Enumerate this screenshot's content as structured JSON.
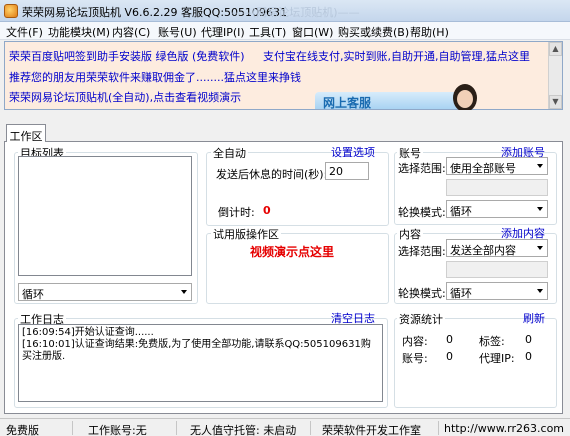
{
  "window": {
    "title": "荣荣网易论坛顶贴机 V6.6.2.29  客服QQ:505109631",
    "ghost_title": "——(网易论坛顶贴机)——"
  },
  "menu": [
    "文件(F)",
    "功能模块(M)",
    "内容(C)",
    "账号(U)",
    "代理IP(I)",
    "工具(T)",
    "窗口(W)",
    "购买或续费(B)",
    "帮助(H)"
  ],
  "banner": {
    "line1a": "荣荣百度贴吧签到助手安装版 绿色版 (免费软件)",
    "line1b": "支付宝在线支付,实时到账,自助开通,自助管理,猛点这里",
    "line2": "推荐您的朋友用荣荣软件来赚取佣金了........猛点这里来挣钱",
    "line3": "荣荣网易论坛顶贴机(全自动),点击查看视频演示",
    "service": "网上客服"
  },
  "tab": {
    "label": "工作区"
  },
  "targets": {
    "title": "目标列表",
    "loop_value": "循环"
  },
  "auto": {
    "title": "全自动",
    "settings_link": "设置选项",
    "rest_label": "发送后休息的时间(秒):",
    "rest_value": "20",
    "countdown_label": "倒计时:",
    "countdown_value": "0"
  },
  "trial": {
    "title": "试用版操作区",
    "video_text": "视频演示点这里"
  },
  "account": {
    "title": "账号",
    "add_link": "添加账号",
    "range_label": "选择范围:",
    "range_value": "使用全部账号",
    "mode_label": "轮换模式:",
    "mode_value": "循环"
  },
  "content": {
    "title": "内容",
    "add_link": "添加内容",
    "range_label": "选择范围:",
    "range_value": "发送全部内容",
    "mode_label": "轮换模式:",
    "mode_value": "循环"
  },
  "log": {
    "title": "工作日志",
    "clear_link": "清空日志",
    "lines": [
      "[16:09:54]开始认证查询......",
      "[16:10:01]认证查询结果:免费版,为了使用全部功能,请联系QQ:505109631购买注册版."
    ]
  },
  "stats": {
    "title": "资源统计",
    "refresh_link": "刷新",
    "content_label": "内容:",
    "content_value": "0",
    "tag_label": "标签:",
    "tag_value": "0",
    "account_label": "账号:",
    "account_value": "0",
    "proxy_label": "代理IP:",
    "proxy_value": "0"
  },
  "status": {
    "edition": "免费版",
    "work_account": "工作账号:无",
    "unattended": "无人值守托管: 未启动",
    "studio": "荣荣软件开发工作室",
    "website": "http://www.rr263.com"
  },
  "colors": {
    "link": "#0000cc",
    "red": "#e60000",
    "banner_bg": "#fdecdf"
  }
}
